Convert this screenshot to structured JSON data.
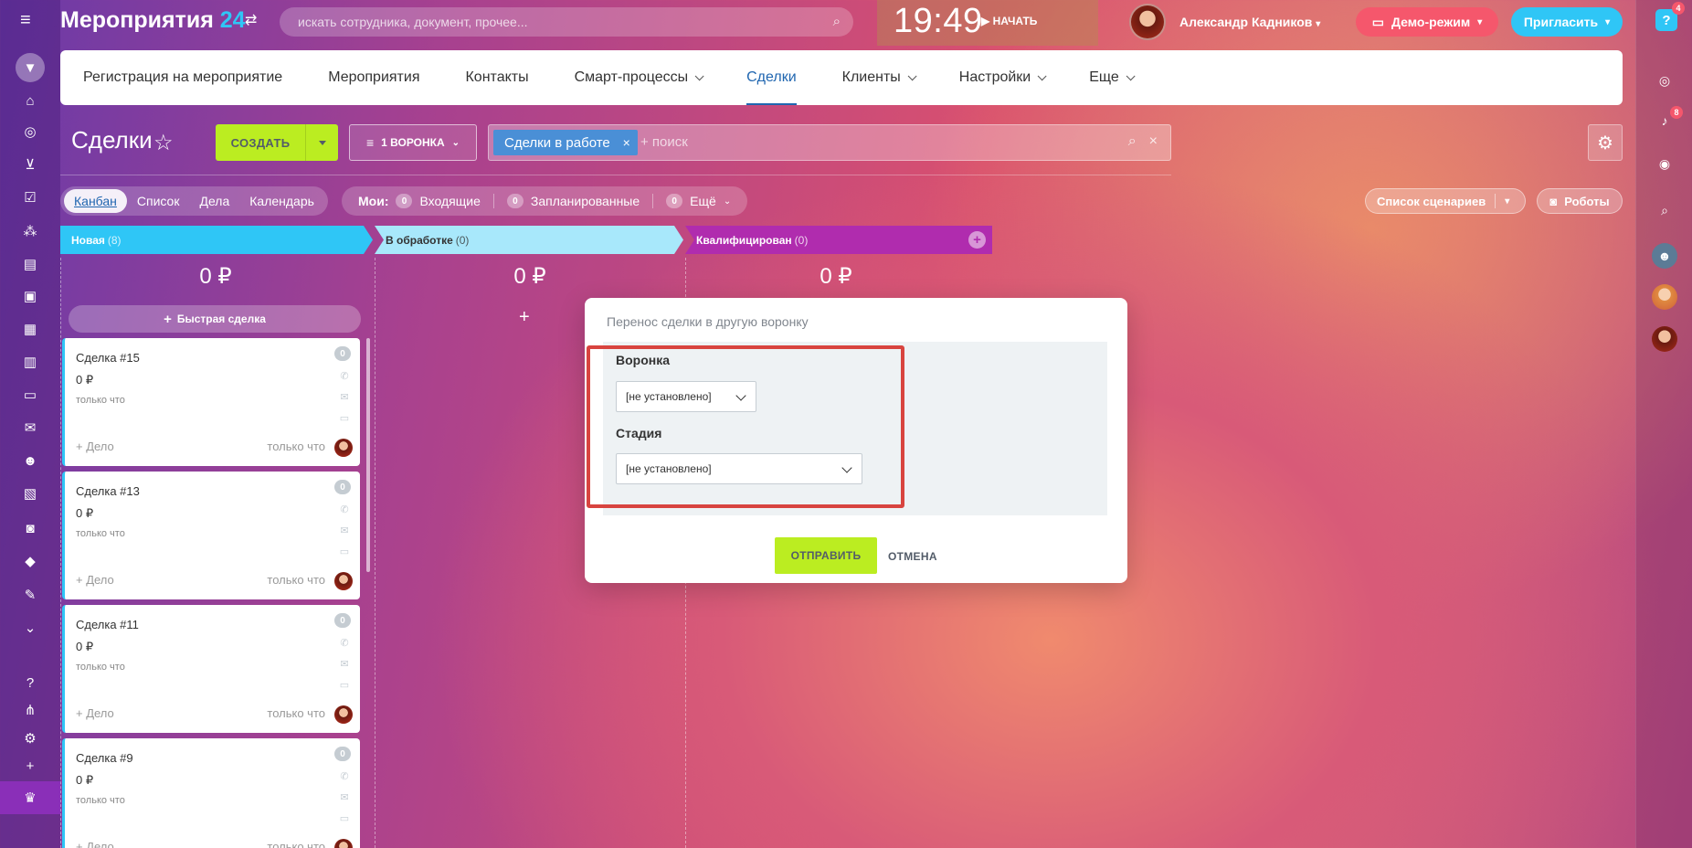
{
  "header": {
    "app_title": "Мероприятия",
    "app_title_num": "24",
    "search_placeholder": "искать сотрудника, документ, прочее...",
    "clock": "19:49",
    "start_label": "НАЧАТЬ",
    "user_name": "Александр Кадников",
    "demo_label": "Демо-режим",
    "invite_label": "Пригласить",
    "help_label": "?",
    "help_badge": "4",
    "notif_badge": "8"
  },
  "top_nav": {
    "items": [
      {
        "label": "Регистрация на мероприятие"
      },
      {
        "label": "Мероприятия"
      },
      {
        "label": "Контакты"
      },
      {
        "label": "Смарт-процессы"
      },
      {
        "label": "Сделки"
      },
      {
        "label": "Клиенты"
      },
      {
        "label": "Настройки"
      },
      {
        "label": "Еще"
      }
    ]
  },
  "toolbar": {
    "page_title": "Сделки",
    "create_label": "СОЗДАТЬ",
    "funnel_label": "1 ВОРОНКА",
    "filter_tag": "Сделки в работе",
    "filter_search": "+ поиск"
  },
  "views": {
    "tabs": [
      "Канбан",
      "Список",
      "Дела",
      "Календарь"
    ],
    "my_label": "Мои:",
    "incoming_count": "0",
    "incoming_label": "Входящие",
    "planned_count": "0",
    "planned_label": "Запланированные",
    "more_count": "0",
    "more_label": "Ещё",
    "scenarios_label": "Список сценариев",
    "robots_label": "Роботы"
  },
  "columns": [
    {
      "title": "Новая",
      "count": "(8)",
      "sum": "0 ₽",
      "color": "#2fc6f6"
    },
    {
      "title": "В обработке",
      "count": "(0)",
      "sum": "0 ₽",
      "color": "#a8e8fb"
    },
    {
      "title": "Квалифицирован",
      "count": "(0)",
      "sum": "0 ₽",
      "color": "#b02cae"
    }
  ],
  "quick_deal_label": "Быстрая сделка",
  "cards": [
    {
      "name": "Сделка #15",
      "amount": "0 ₽",
      "time": "только что",
      "add_task": "+ Дело",
      "time2": "только что",
      "count": "0"
    },
    {
      "name": "Сделка #13",
      "amount": "0 ₽",
      "time": "только что",
      "add_task": "+ Дело",
      "time2": "только что",
      "count": "0"
    },
    {
      "name": "Сделка #11",
      "amount": "0 ₽",
      "time": "только что",
      "add_task": "+ Дело",
      "time2": "только что",
      "count": "0"
    },
    {
      "name": "Сделка #9",
      "amount": "0 ₽",
      "time": "только что",
      "add_task": "+ Дело",
      "time2": "только что",
      "count": "0"
    }
  ],
  "modal": {
    "title": "Перенос сделки в другую воронку",
    "funnel_label": "Воронка",
    "funnel_value": "[не установлено]",
    "stage_label": "Стадия",
    "stage_value": "[не установлено]",
    "send_label": "ОТПРАВИТЬ",
    "cancel_label": "ОТМЕНА"
  },
  "colors": {
    "accent_green": "#bbed21",
    "accent_blue": "#2fc6f6",
    "highlight_red": "#d8443f"
  }
}
